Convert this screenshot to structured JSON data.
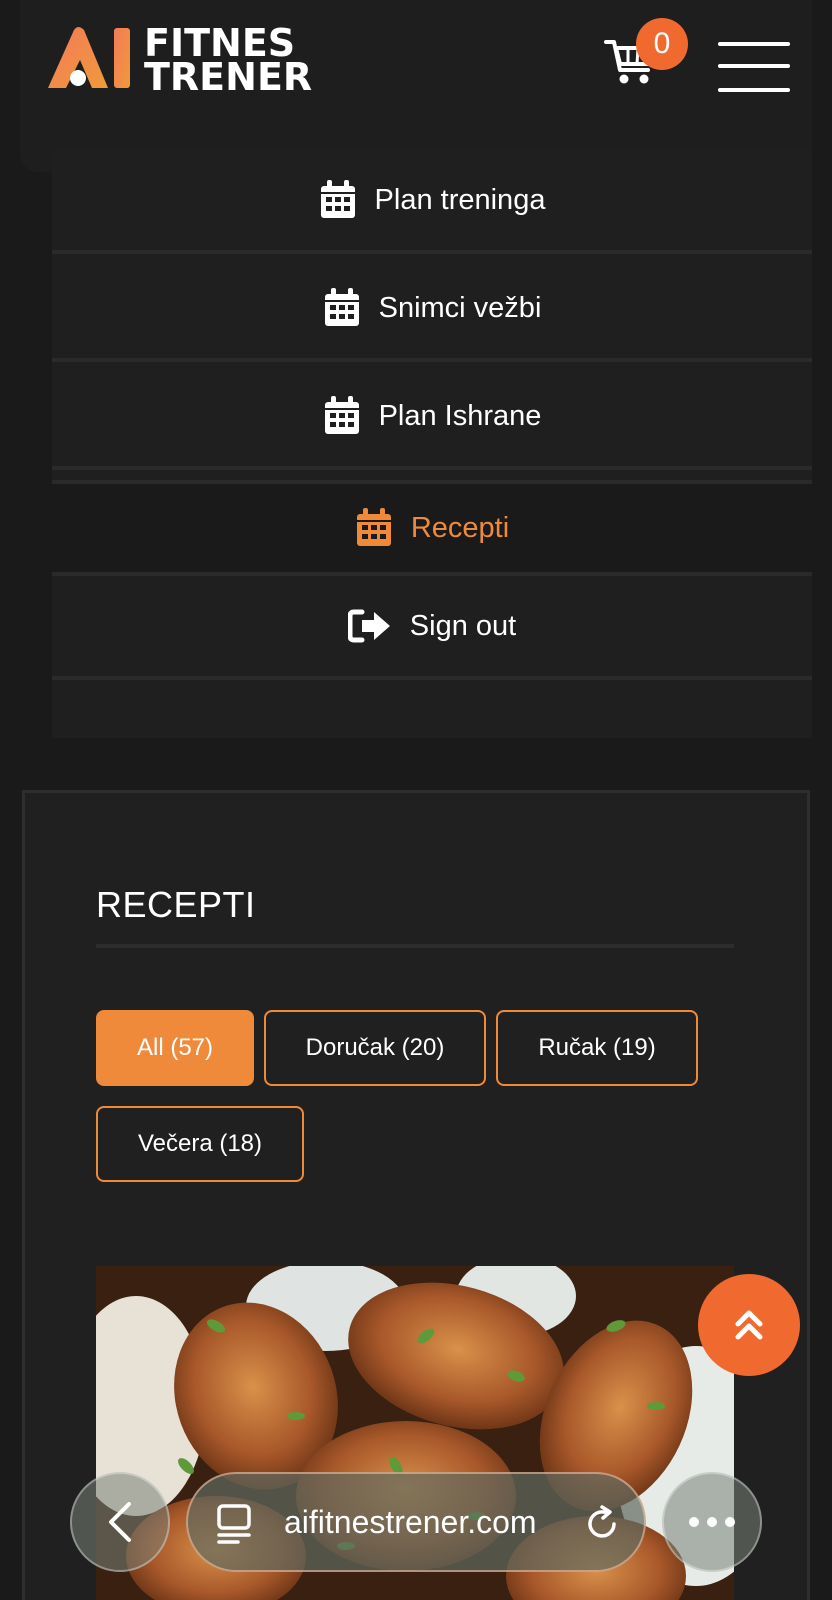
{
  "header": {
    "logo_mark": "AI",
    "logo_line1": "FITNES",
    "logo_line2": "TRENER",
    "cart_count": "0"
  },
  "nav": {
    "items": [
      {
        "label": "Plan treninga",
        "icon": "calendar-icon"
      },
      {
        "label": "Snimci vežbi",
        "icon": "calendar-icon"
      },
      {
        "label": "Plan Ishrane",
        "icon": "calendar-icon"
      },
      {
        "label": "Recepti",
        "icon": "calendar-icon",
        "active": true
      },
      {
        "label": "Sign out",
        "icon": "sign-out-icon"
      }
    ]
  },
  "recipes": {
    "title": "RECEPTI",
    "filters": [
      {
        "label": "All (57)",
        "active": true
      },
      {
        "label": "Doručak (20)"
      },
      {
        "label": "Ručak (19)"
      },
      {
        "label": "Večera (18)"
      }
    ]
  },
  "browser": {
    "url": "aifitnestrener.com"
  },
  "colors": {
    "accent": "#ef8a3a",
    "badge": "#f06a2f",
    "background": "#1a1a1a",
    "panel": "#1f1f20"
  }
}
